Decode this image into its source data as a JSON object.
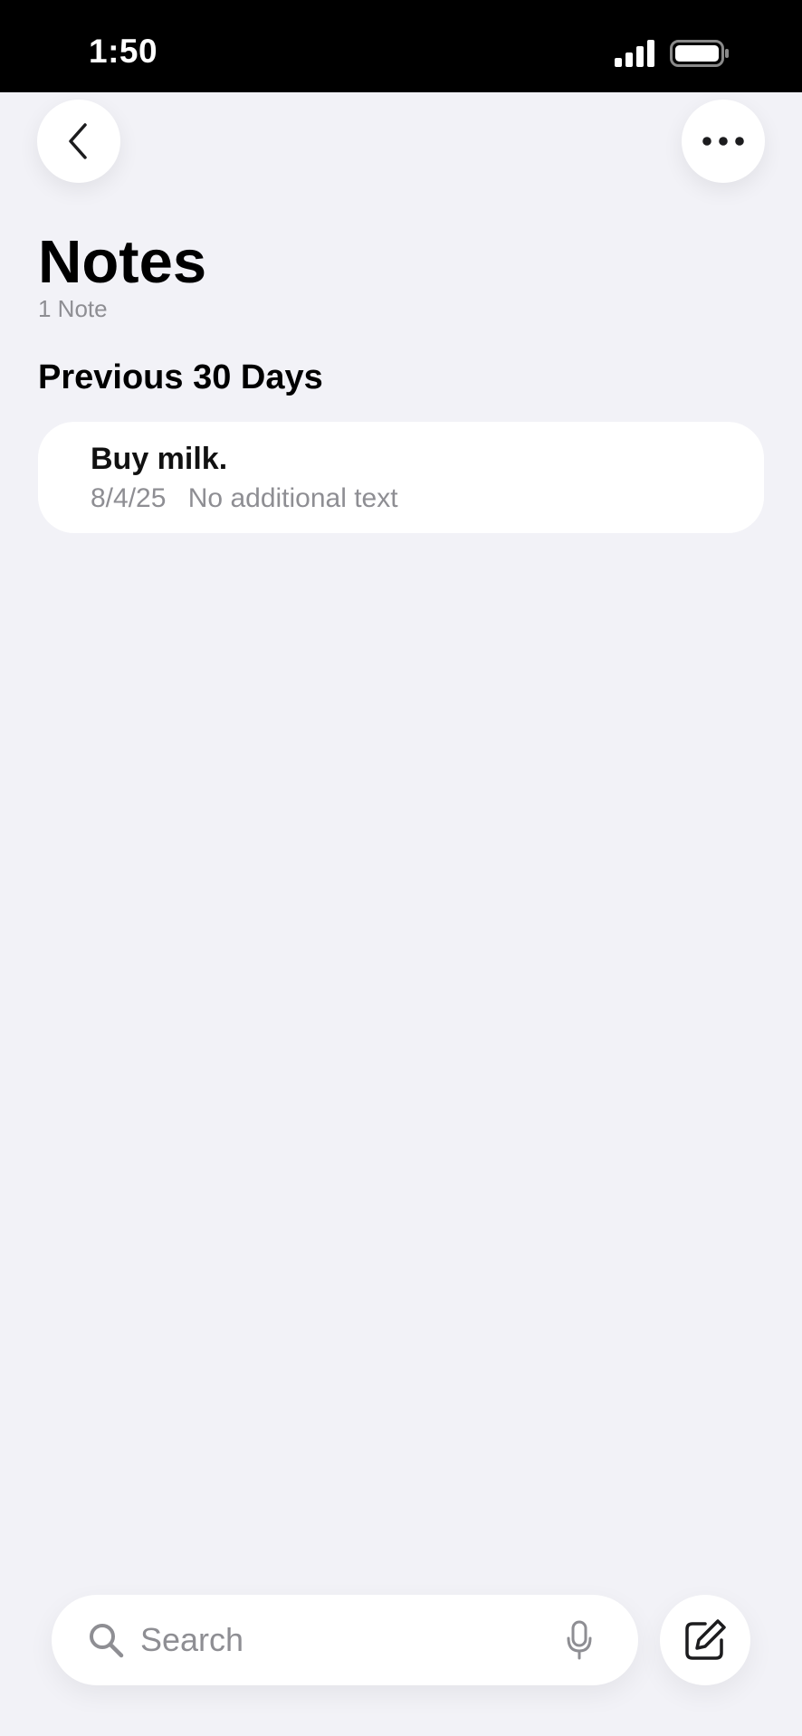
{
  "status_bar": {
    "time": "1:50"
  },
  "header": {
    "back_icon": "chevron-left-icon",
    "more_icon": "ellipsis-icon"
  },
  "page": {
    "title": "Notes",
    "count": "1 Note"
  },
  "sections": [
    {
      "header": "Previous 30 Days",
      "notes": [
        {
          "title": "Buy milk.",
          "date": "8/4/25",
          "preview": "No additional text"
        }
      ]
    }
  ],
  "toolbar": {
    "search_placeholder": "Search",
    "search_icon": "magnifying-glass-icon",
    "mic_icon": "microphone-icon",
    "compose_icon": "compose-icon"
  },
  "colors": {
    "background": "#F2F2F7",
    "card": "#FFFFFF",
    "secondary_text": "#8E8E93"
  }
}
